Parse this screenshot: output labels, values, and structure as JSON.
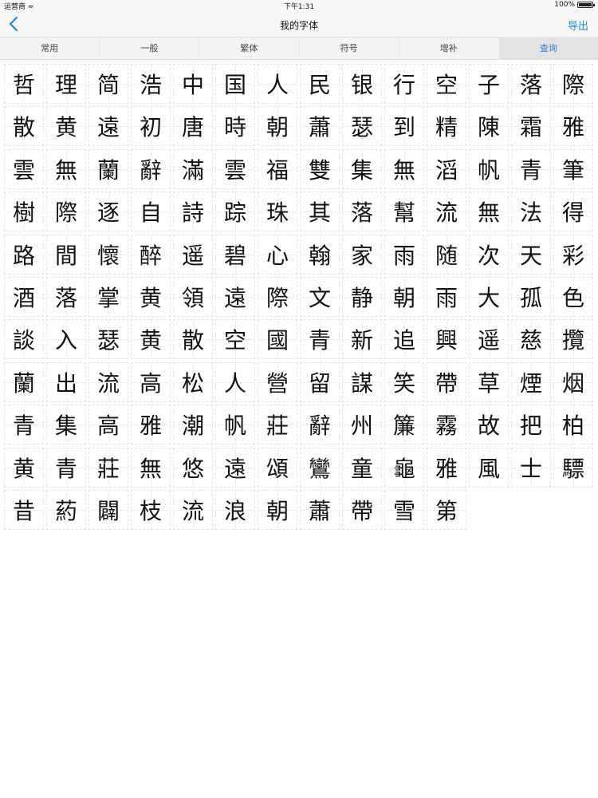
{
  "status_bar": {
    "carrier": "运营商",
    "time": "下午1:31",
    "battery": "100%",
    "battery_level": 1.0
  },
  "nav": {
    "title": "我的字体",
    "export_label": "导出"
  },
  "tabs": [
    {
      "label": "常用",
      "active": false
    },
    {
      "label": "一般",
      "active": false
    },
    {
      "label": "繁体",
      "active": false
    },
    {
      "label": "符号",
      "active": false
    },
    {
      "label": "增补",
      "active": false
    },
    {
      "label": "查询",
      "active": true
    }
  ],
  "colors": {
    "accent": "#1e88e5",
    "active_tab_bg": "#e3e3e3",
    "cell_border": "#e3e3e3"
  },
  "characters": [
    "哲",
    "理",
    "简",
    "浩",
    "中",
    "国",
    "人",
    "民",
    "银",
    "行",
    "空",
    "子",
    "落",
    "際",
    "散",
    "黄",
    "遠",
    "初",
    "唐",
    "時",
    "朝",
    "蕭",
    "瑟",
    "到",
    "精",
    "陳",
    "霜",
    "雅",
    "雲",
    "無",
    "蘭",
    "辭",
    "滿",
    "雲",
    "福",
    "雙",
    "集",
    "無",
    "滔",
    "帆",
    "青",
    "筆",
    "樹",
    "際",
    "逐",
    "自",
    "詩",
    "踪",
    "珠",
    "其",
    "落",
    "幫",
    "流",
    "無",
    "法",
    "得",
    "路",
    "間",
    "懷",
    "醉",
    "遥",
    "碧",
    "心",
    "翰",
    "家",
    "雨",
    "随",
    "次",
    "天",
    "彩",
    "酒",
    "落",
    "掌",
    "黄",
    "領",
    "遠",
    "際",
    "文",
    "静",
    "朝",
    "雨",
    "大",
    "孤",
    "色",
    "談",
    "入",
    "瑟",
    "黄",
    "散",
    "空",
    "國",
    "青",
    "新",
    "追",
    "興",
    "遥",
    "慈",
    "攬",
    "蘭",
    "出",
    "流",
    "高",
    "松",
    "人",
    "營",
    "留",
    "謀",
    "笑",
    "帶",
    "草",
    "煙",
    "烟",
    "青",
    "集",
    "高",
    "雅",
    "潮",
    "帆",
    "莊",
    "辭",
    "州",
    "簾",
    "霧",
    "故",
    "把",
    "柏",
    "黄",
    "青",
    "莊",
    "無",
    "悠",
    "遠",
    "頌",
    "鸞",
    "童",
    "龜",
    "雅",
    "風",
    "士",
    "驃",
    "昔",
    "葯",
    "闢",
    "枝",
    "流",
    "浪",
    "朝",
    "蕭",
    "帶",
    "雪",
    "第"
  ]
}
